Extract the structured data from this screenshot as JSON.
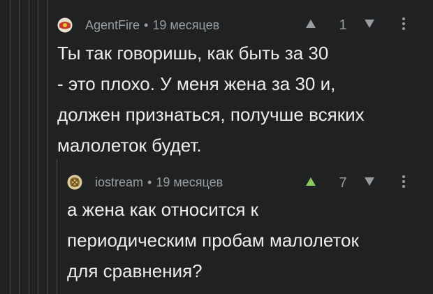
{
  "comments": [
    {
      "username": "AgentFire",
      "separator": "•",
      "time": "19 месяцев",
      "score": "1",
      "voted_up": false,
      "text": "Ты так говоришь, как быть за 30\n- это плохо. У меня жена за 30 и,\nдолжен признаться, получше всяких\nмалолеток будет.",
      "avatar_icon": "avatar-icon"
    },
    {
      "username": "iostream",
      "separator": "•",
      "time": "19 месяцев",
      "score": "7",
      "voted_up": true,
      "text": "а жена как относится к\nпериодическим пробам малолеток\nдля сравнения?",
      "avatar_icon": "avatar-icon"
    }
  ],
  "colors": {
    "background": "#1f2123",
    "thread_line": "#4a4d50",
    "meta_text": "#9a9d9f",
    "body_text": "#ececec",
    "upvote_active": "#8ac858",
    "vote_inactive": "#9a9d9f"
  },
  "icons": {
    "upvote": "upvote-arrow-icon",
    "downvote": "downvote-arrow-icon",
    "more": "more-options-icon"
  }
}
